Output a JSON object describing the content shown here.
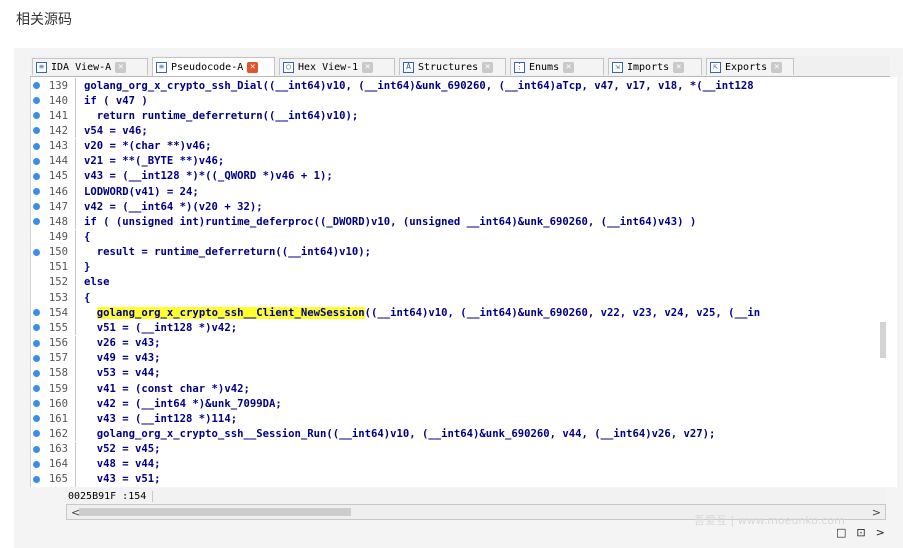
{
  "page": {
    "heading": "相关源码"
  },
  "tabs": [
    {
      "label": "IDA View-A",
      "icon": "view-icon",
      "icon_glyph": "≡",
      "active": false
    },
    {
      "label": "Pseudocode-A",
      "icon": "pseudocode-icon",
      "icon_glyph": "≡",
      "active": true
    },
    {
      "label": "Hex View-1",
      "icon": "hex-icon",
      "icon_glyph": "○",
      "active": false
    },
    {
      "label": "Structures",
      "icon": "structures-icon",
      "icon_glyph": "A",
      "active": false
    },
    {
      "label": "Enums",
      "icon": "enums-icon",
      "icon_glyph": "⋮",
      "active": false
    },
    {
      "label": "Imports",
      "icon": "imports-icon",
      "icon_glyph": "⇲",
      "active": false
    },
    {
      "label": "Exports",
      "icon": "exports-icon",
      "icon_glyph": "⇱",
      "active": false
    }
  ],
  "tab_close_glyph": "✕",
  "code_lines": [
    {
      "num": "139",
      "bp": true,
      "pre": "golang_org_x_crypto_ssh_Dial((__int64)v10, (__int64)&unk_690260, (__int64)aTcp, v47, v17, v18, *(__int128",
      "hl": "",
      "post": ""
    },
    {
      "num": "140",
      "bp": true,
      "pre": "if ( v47 )",
      "hl": "",
      "post": ""
    },
    {
      "num": "141",
      "bp": true,
      "pre": "  return runtime_deferreturn((__int64)v10);",
      "hl": "",
      "post": ""
    },
    {
      "num": "142",
      "bp": true,
      "pre": "v54 = v46;",
      "hl": "",
      "post": ""
    },
    {
      "num": "143",
      "bp": true,
      "pre": "v20 = *(char **)v46;",
      "hl": "",
      "post": ""
    },
    {
      "num": "144",
      "bp": true,
      "pre": "v21 = **(_BYTE **)v46;",
      "hl": "",
      "post": ""
    },
    {
      "num": "145",
      "bp": true,
      "pre": "v43 = (__int128 *)*((_QWORD *)v46 + 1);",
      "hl": "",
      "post": ""
    },
    {
      "num": "146",
      "bp": true,
      "pre": "LODWORD(v41) = 24;",
      "hl": "",
      "post": ""
    },
    {
      "num": "147",
      "bp": true,
      "pre": "v42 = (__int64 *)(v20 + 32);",
      "hl": "",
      "post": ""
    },
    {
      "num": "148",
      "bp": true,
      "pre": "if ( (unsigned int)runtime_deferproc((_DWORD)v10, (unsigned __int64)&unk_690260, (__int64)v43) )",
      "hl": "",
      "post": ""
    },
    {
      "num": "149",
      "bp": false,
      "pre": "{",
      "hl": "",
      "post": ""
    },
    {
      "num": "150",
      "bp": true,
      "pre": "  result = runtime_deferreturn((__int64)v10);",
      "hl": "",
      "post": ""
    },
    {
      "num": "151",
      "bp": false,
      "pre": "}",
      "hl": "",
      "post": ""
    },
    {
      "num": "152",
      "bp": false,
      "pre": "else",
      "hl": "",
      "post": ""
    },
    {
      "num": "153",
      "bp": false,
      "pre": "{",
      "hl": "",
      "post": ""
    },
    {
      "num": "154",
      "bp": true,
      "pre": "  ",
      "hl": "golang_org_x_crypto_ssh__Client_NewSession",
      "post": "((__int64)v10, (__int64)&unk_690260, v22, v23, v24, v25, (__in"
    },
    {
      "num": "155",
      "bp": true,
      "pre": "  v51 = (__int128 *)v42;",
      "hl": "",
      "post": ""
    },
    {
      "num": "156",
      "bp": true,
      "pre": "  v26 = v43;",
      "hl": "",
      "post": ""
    },
    {
      "num": "157",
      "bp": true,
      "pre": "  v49 = v43;",
      "hl": "",
      "post": ""
    },
    {
      "num": "158",
      "bp": true,
      "pre": "  v53 = v44;",
      "hl": "",
      "post": ""
    },
    {
      "num": "159",
      "bp": true,
      "pre": "  v41 = (const char *)v42;",
      "hl": "",
      "post": ""
    },
    {
      "num": "160",
      "bp": true,
      "pre": "  v42 = (__int64 *)&unk_7099DA;",
      "hl": "",
      "post": ""
    },
    {
      "num": "161",
      "bp": true,
      "pre": "  v43 = (__int128 *)114;",
      "hl": "",
      "post": ""
    },
    {
      "num": "162",
      "bp": true,
      "pre": "  golang_org_x_crypto_ssh__Session_Run((__int64)v10, (__int64)&unk_690260, v44, (__int64)v26, v27);",
      "hl": "",
      "post": ""
    },
    {
      "num": "163",
      "bp": true,
      "pre": "  v52 = v45;",
      "hl": "",
      "post": ""
    },
    {
      "num": "164",
      "bp": true,
      "pre": "  v48 = v44;",
      "hl": "",
      "post": ""
    },
    {
      "num": "165",
      "bp": true,
      "pre": "  v43 = v51;",
      "hl": "",
      "post": ""
    }
  ],
  "status": {
    "position": "0025B91F :154"
  },
  "scroll": {
    "left_arrow": "<",
    "right_arrow": ">"
  },
  "window_controls": {
    "restore": "□",
    "float": "⊡",
    "more": ">"
  },
  "watermark": "吾爱互 | www.moeunko.com",
  "colors": {
    "code_text": "#000087",
    "highlight": "#ffff30",
    "breakpoint": "#3b8ee8",
    "active_close": "#e2542c"
  }
}
